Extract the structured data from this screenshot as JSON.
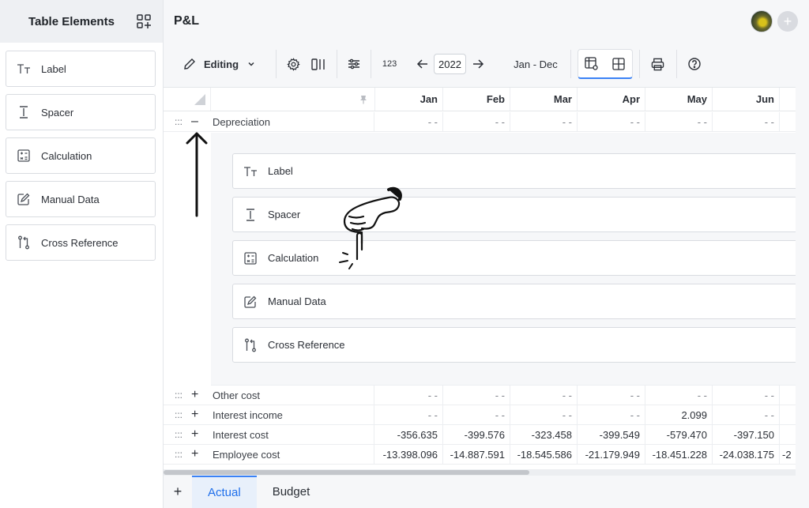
{
  "sidebar": {
    "title": "Table Elements",
    "items": [
      {
        "label": "Label",
        "icon": "text-type-icon"
      },
      {
        "label": "Spacer",
        "icon": "spacer-icon"
      },
      {
        "label": "Calculation",
        "icon": "calculator-icon"
      },
      {
        "label": "Manual Data",
        "icon": "edit-icon"
      },
      {
        "label": "Cross Reference",
        "icon": "cross-reference-icon"
      }
    ]
  },
  "header": {
    "title": "P&L",
    "add_symbol": "+"
  },
  "toolbar": {
    "mode_label": "Editing",
    "number_format": "123",
    "year": "2022",
    "period": "Jan - Dec"
  },
  "table": {
    "months": [
      "Jan",
      "Feb",
      "Mar",
      "Apr",
      "May",
      "Jun"
    ],
    "rows": [
      {
        "label": "Depreciation",
        "toggle": "–",
        "values": [
          "- -",
          "- -",
          "- -",
          "- -",
          "- -",
          "- -"
        ]
      },
      {
        "label": "Other cost",
        "toggle": "+",
        "values": [
          "- -",
          "- -",
          "- -",
          "- -",
          "- -",
          "- -"
        ]
      },
      {
        "label": "Interest income",
        "toggle": "+",
        "values": [
          "- -",
          "- -",
          "- -",
          "- -",
          "2.099",
          "- -"
        ]
      },
      {
        "label": "Interest cost",
        "toggle": "+",
        "values": [
          "-356.635",
          "-399.576",
          "-323.458",
          "-399.549",
          "-579.470",
          "-397.150"
        ]
      },
      {
        "label": "Employee cost",
        "toggle": "+",
        "values": [
          "-13.398.096",
          "-14.887.591",
          "-18.545.586",
          "-21.179.949",
          "-18.451.228",
          "-24.038.175"
        ],
        "overflow": "-2"
      }
    ],
    "handle_glyph": ":::"
  },
  "panel": {
    "items": [
      {
        "label": "Label",
        "icon": "text-type-icon"
      },
      {
        "label": "Spacer",
        "icon": "spacer-icon"
      },
      {
        "label": "Calculation",
        "icon": "calculator-icon"
      },
      {
        "label": "Manual Data",
        "icon": "edit-icon"
      },
      {
        "label": "Cross Reference",
        "icon": "cross-reference-icon"
      }
    ]
  },
  "tabs": {
    "add_symbol": "+",
    "items": [
      "Actual",
      "Budget"
    ],
    "active": "Actual"
  },
  "colors": {
    "accent": "#3b82f6",
    "active_tab_text": "#1f6feb"
  }
}
